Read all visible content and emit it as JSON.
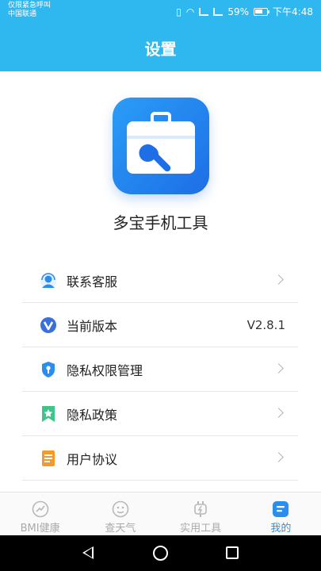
{
  "status_bar": {
    "line1": "仅限紧急呼叫",
    "line2": "中国联通",
    "battery": "59%",
    "time": "下午4:48"
  },
  "header": {
    "title": "设置"
  },
  "app": {
    "name": "多宝手机工具",
    "icon": "toolbox-wrench-icon"
  },
  "menu": [
    {
      "label": "联系客服",
      "icon": "headset-avatar-icon",
      "chevron": true
    },
    {
      "label": "当前版本",
      "icon": "v-badge-icon",
      "value": "V2.8.1"
    },
    {
      "label": "隐私权限管理",
      "icon": "shield-key-icon",
      "chevron": true
    },
    {
      "label": "隐私政策",
      "icon": "bookmark-star-icon",
      "chevron": true
    },
    {
      "label": "用户协议",
      "icon": "document-icon",
      "chevron": true
    }
  ],
  "tabs": [
    {
      "label": "BMI健康",
      "icon": "trend-circle-icon",
      "active": false
    },
    {
      "label": "查天气",
      "icon": "weather-face-icon",
      "active": false
    },
    {
      "label": "实用工具",
      "icon": "plug-bolt-icon",
      "active": false
    },
    {
      "label": "我的",
      "icon": "profile-card-icon",
      "active": true
    }
  ],
  "colors": {
    "header": "#2fb8f0",
    "accent": "#2a8df0"
  }
}
